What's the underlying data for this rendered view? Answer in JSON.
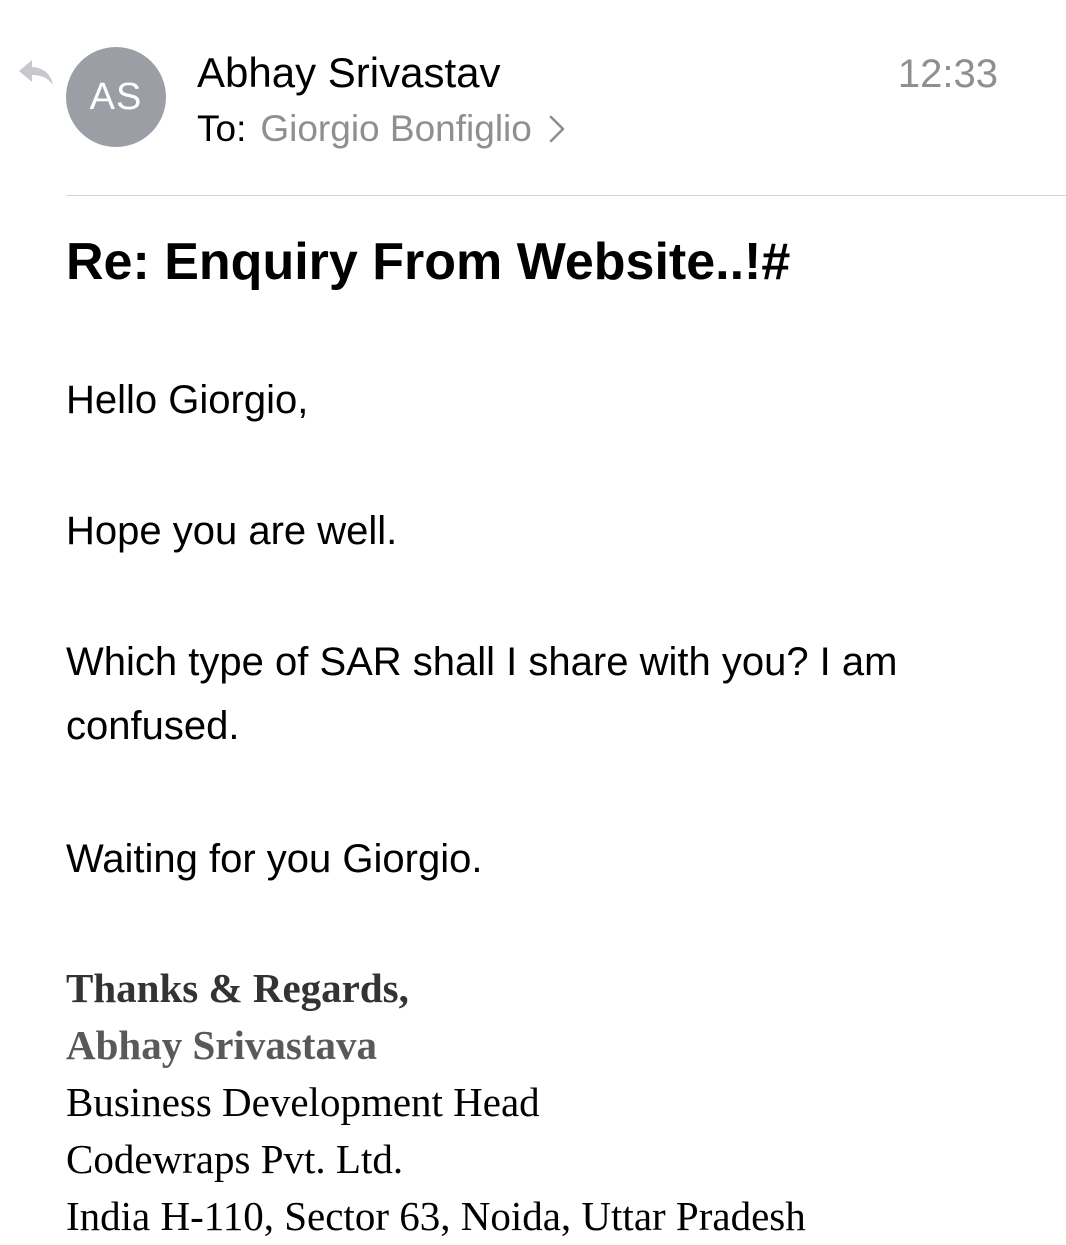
{
  "header": {
    "avatar_initials": "AS",
    "sender_name": "Abhay Srivastav",
    "time": "12:33",
    "to_label": "To:",
    "recipient": "Giorgio Bonfiglio",
    "icons": {
      "reply": "reply-arrow-icon",
      "chevron": "chevron-right-icon"
    }
  },
  "subject": "Re: Enquiry From Website..!#",
  "body": {
    "paragraphs": [
      "Hello Giorgio,",
      "Hope you are well.",
      "Which type of SAR shall I share with you? I am confused.",
      "Waiting for you Giorgio."
    ]
  },
  "signature": {
    "closing": "Thanks & Regards,",
    "name": "Abhay Srivastava",
    "title": "Business Development Head",
    "company": "Codewraps Pvt. Ltd.",
    "address_partial": "India H-110, Sector 63, Noida, Uttar Pradesh"
  },
  "colors": {
    "avatar_bg": "#9c9ea6",
    "secondary_text": "#8e8e93",
    "divider": "#d1d1d6",
    "reply_icon": "#c7c7cc"
  }
}
